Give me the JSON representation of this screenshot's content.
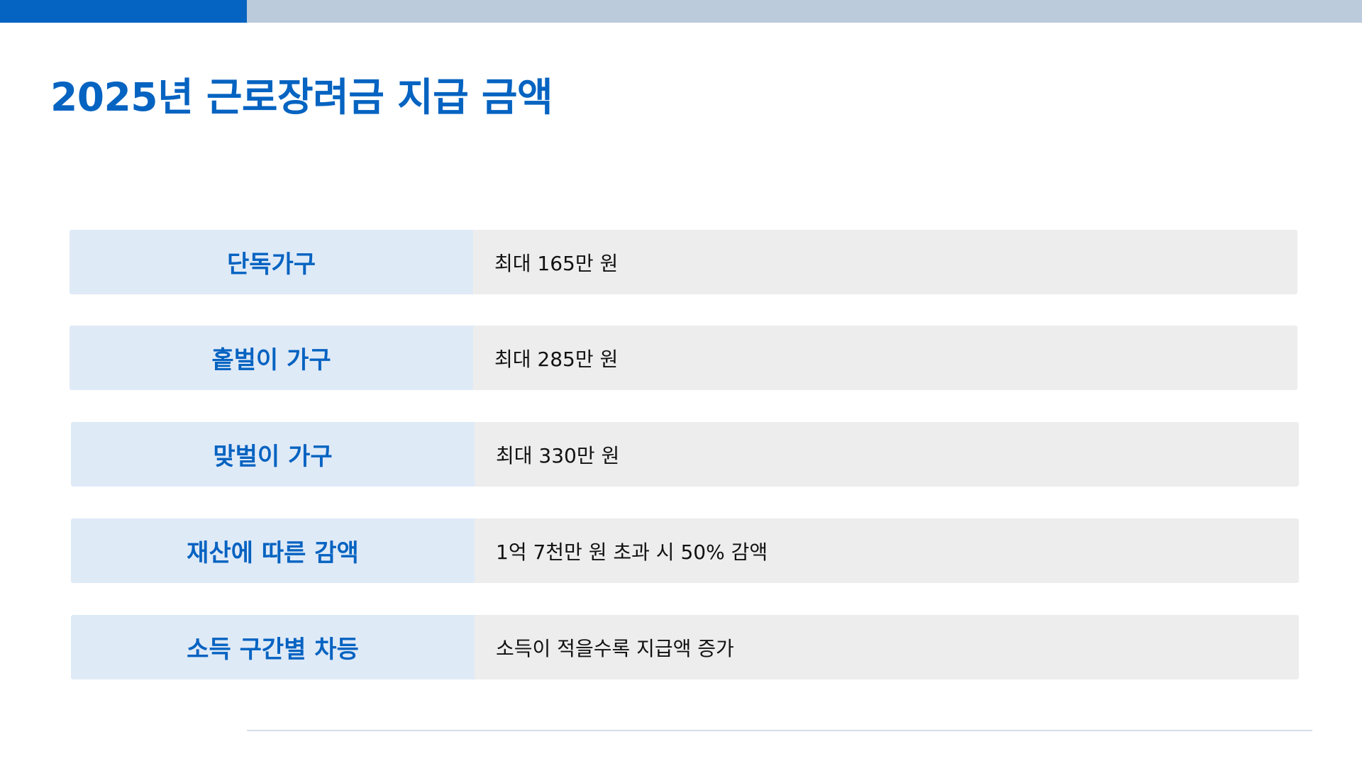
{
  "title": "2025년 근로장려금 지급 금액",
  "rows": [
    {
      "label": "단독가구",
      "value": "최대 165만 원"
    },
    {
      "label": "홑벌이 가구",
      "value": "최대 285만 원"
    },
    {
      "label": "맞벌이 가구",
      "value": "최대 330만 원"
    },
    {
      "label": "재산에 따른 감액",
      "value": "1억 7천만 원 초과 시 50% 감액"
    },
    {
      "label": "소득 구간별 차등",
      "value": "소득이 적을수록 지급액 증가"
    }
  ],
  "colors": {
    "accent": "#0563c1",
    "label_bg": "#dfeaf7",
    "value_bg": "#ededed",
    "top_bar_track": "#bccbdb"
  }
}
